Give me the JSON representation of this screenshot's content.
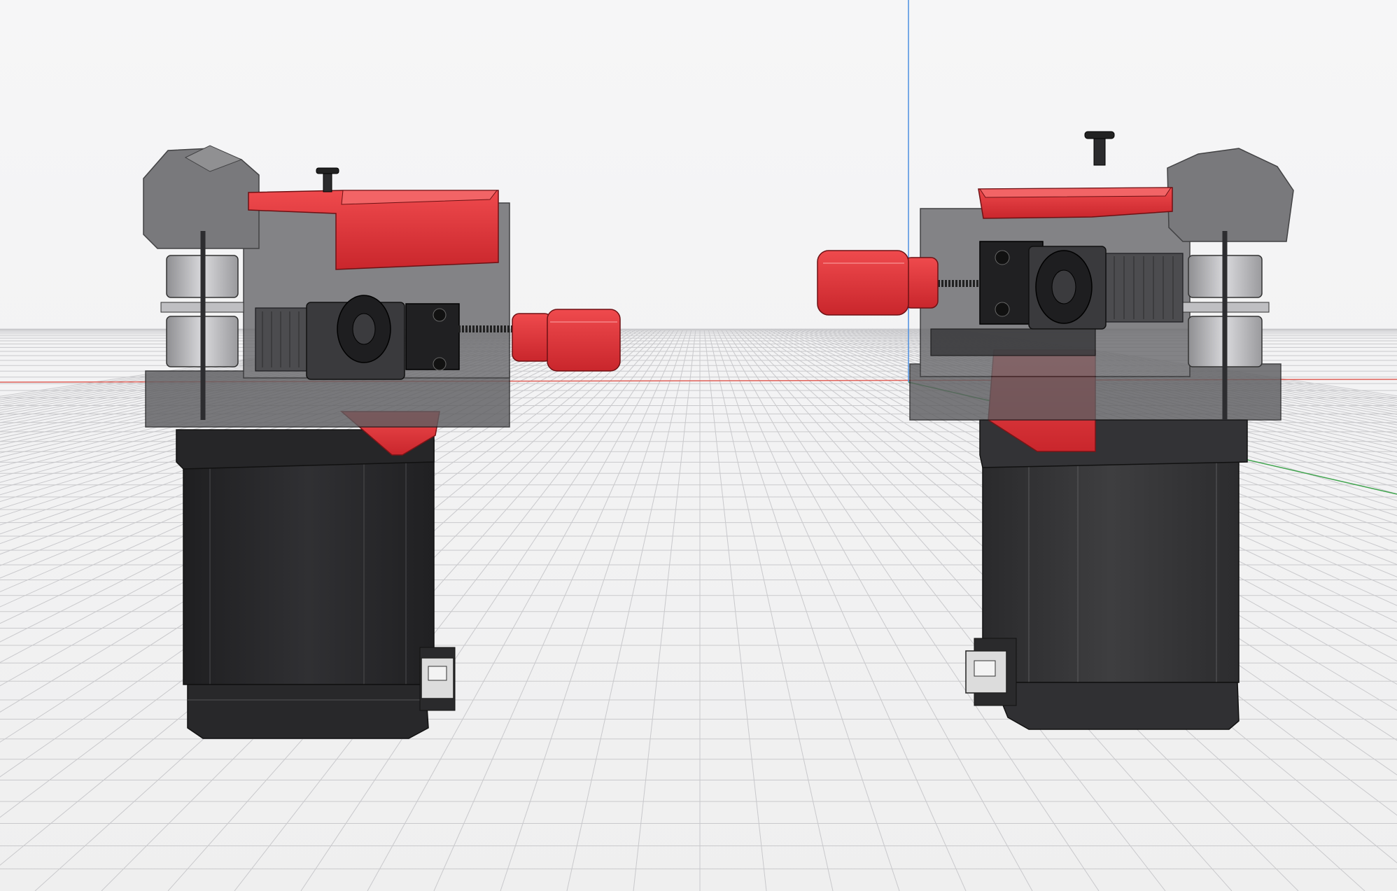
{
  "viewport": {
    "title": "",
    "background_color": "#f3f3f4",
    "grid_color": "#c9c9cc",
    "axes": [
      {
        "name": "x-axis",
        "color": "#e0625a"
      },
      {
        "name": "y-axis",
        "color": "#3fa34d"
      },
      {
        "name": "z-axis",
        "color": "#4c8fe0"
      }
    ]
  },
  "models": [
    {
      "name": "extruder-left",
      "facing": "right",
      "accent_color": "#e0343a",
      "body_color": "#2c2c2e",
      "housing_color": "#5d5d60"
    },
    {
      "name": "extruder-right",
      "facing": "left",
      "accent_color": "#e0343a",
      "body_color": "#2c2c2e",
      "housing_color": "#5d5d60"
    }
  ]
}
